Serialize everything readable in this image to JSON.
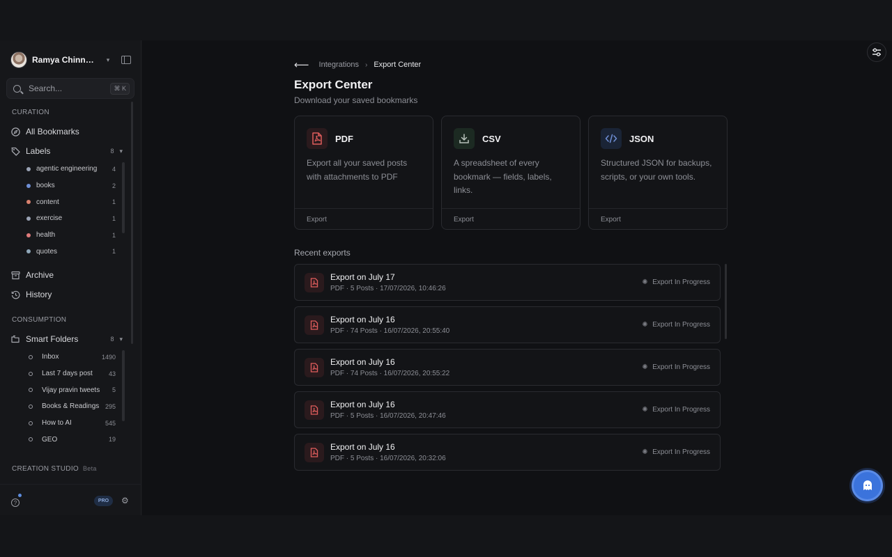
{
  "sidebar": {
    "user_name": "Ramya Chinnadurai",
    "search": {
      "placeholder": "Search...",
      "shortcut": "⌘ K"
    },
    "curation_label": "CURATION",
    "all_bookmarks": "All Bookmarks",
    "labels": {
      "label": "Labels",
      "count": "8"
    },
    "label_items": [
      {
        "name": "agentic engineering",
        "count": "4",
        "color": "#9aa3b5"
      },
      {
        "name": "books",
        "count": "2",
        "color": "#6f8fd6"
      },
      {
        "name": "content",
        "count": "1",
        "color": "#d9826f"
      },
      {
        "name": "exercise",
        "count": "1",
        "color": "#9aa3b5"
      },
      {
        "name": "health",
        "count": "1",
        "color": "#e07b7b"
      },
      {
        "name": "quotes",
        "count": "1",
        "color": "#8fa7b8"
      }
    ],
    "archive": "Archive",
    "history": "History",
    "consumption_label": "CONSUMPTION",
    "smart_folders": {
      "label": "Smart Folders",
      "count": "8"
    },
    "folder_items": [
      {
        "name": "Inbox",
        "count": "1490"
      },
      {
        "name": "Last 7 days post",
        "count": "43"
      },
      {
        "name": "Vijay pravin tweets",
        "count": "5"
      },
      {
        "name": "Books & Readings",
        "count": "295"
      },
      {
        "name": "How to AI",
        "count": "545"
      },
      {
        "name": "GEO",
        "count": "19"
      }
    ],
    "creation_label": "CREATION STUDIO",
    "creation_badge": "Beta",
    "pro_badge": "PRO"
  },
  "main": {
    "breadcrumb": {
      "parent": "Integrations",
      "current": "Export Center"
    },
    "title": "Export Center",
    "subtitle": "Download your saved bookmarks",
    "cards": [
      {
        "title": "PDF",
        "description": "Export all your saved posts with attachments to PDF",
        "action": "Export",
        "icon": "pdf-file-icon"
      },
      {
        "title": "CSV",
        "description": "A spreadsheet of every bookmark — fields, labels, links.",
        "action": "Export",
        "icon": "download-icon"
      },
      {
        "title": "JSON",
        "description": "Structured JSON for backups, scripts, or your own tools.",
        "action": "Export",
        "icon": "code-icon"
      }
    ],
    "recent_label": "Recent exports",
    "exports": [
      {
        "title": "Export on July 17",
        "meta": "PDF · 5 Posts · 17/07/2026, 10:46:26",
        "status": "Export In Progress"
      },
      {
        "title": "Export on July 16",
        "meta": "PDF · 74 Posts · 16/07/2026, 20:55:40",
        "status": "Export In Progress"
      },
      {
        "title": "Export on July 16",
        "meta": "PDF · 74 Posts · 16/07/2026, 20:55:22",
        "status": "Export In Progress"
      },
      {
        "title": "Export on July 16",
        "meta": "PDF · 5 Posts · 16/07/2026, 20:47:46",
        "status": "Export In Progress"
      },
      {
        "title": "Export on July 16",
        "meta": "PDF · 5 Posts · 16/07/2026, 20:32:06",
        "status": "Export In Progress"
      }
    ]
  },
  "colors": {
    "accent": "#3b73dc",
    "pdf_red": "#e05d5d",
    "csv_green": "#1c2a22",
    "json_blue": "#1a2436"
  }
}
